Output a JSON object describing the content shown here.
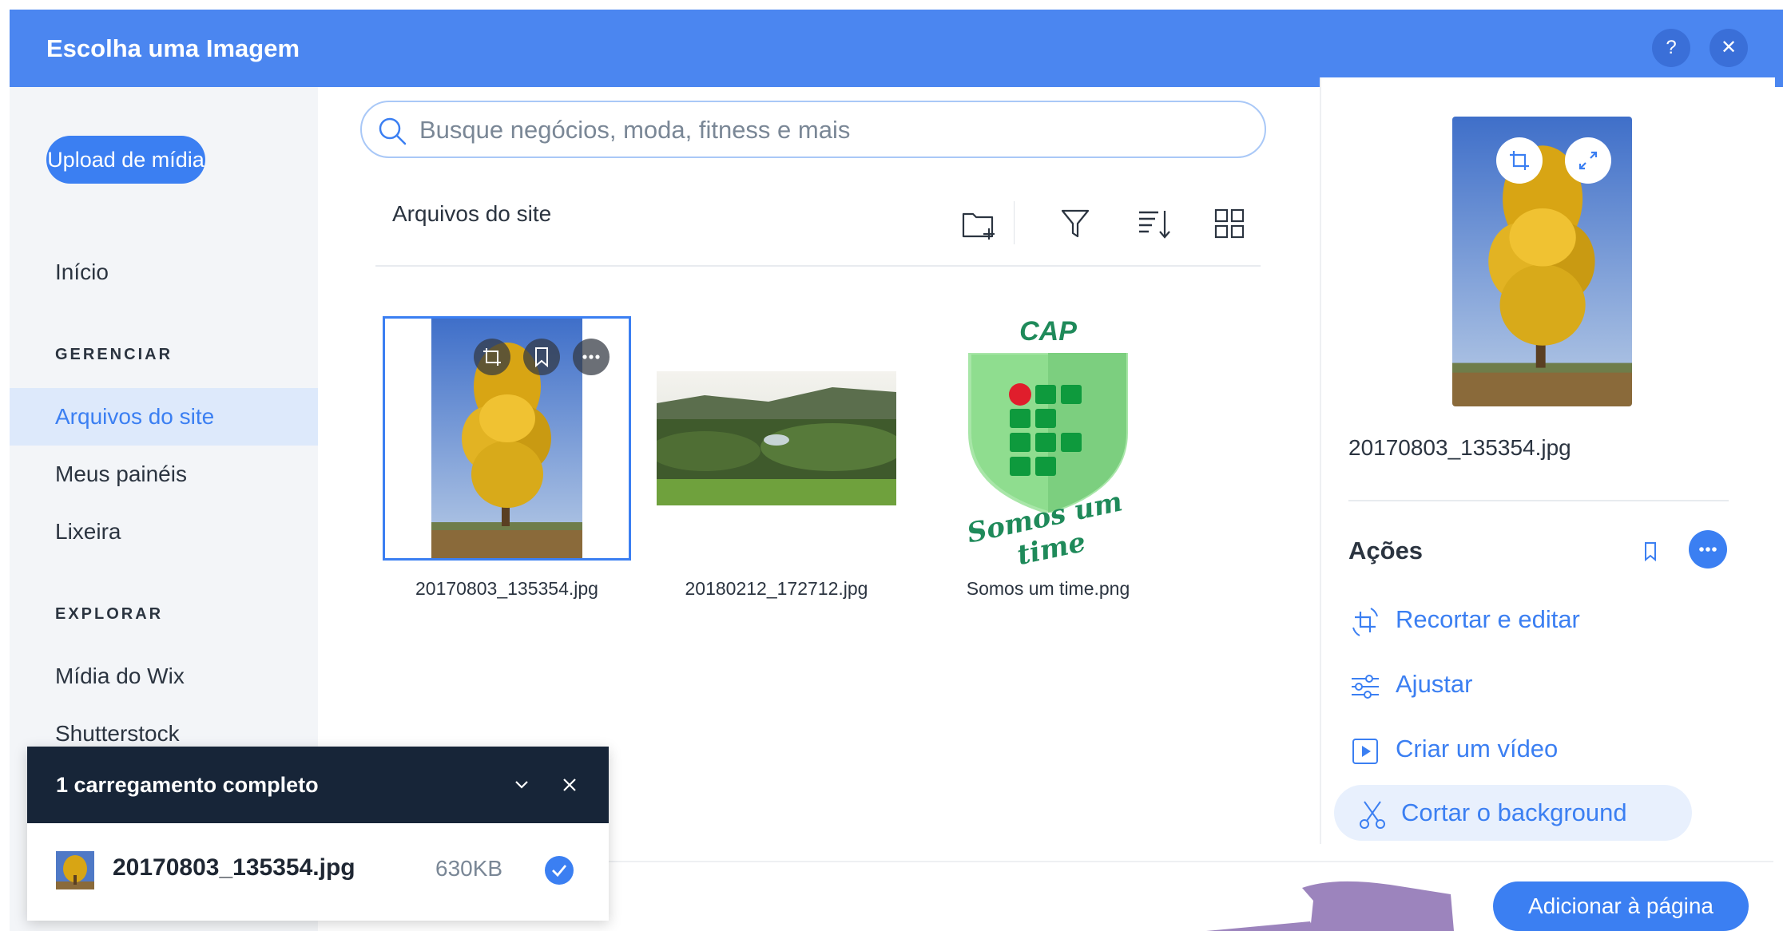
{
  "header": {
    "title": "Escolha uma Imagem",
    "help_label": "?",
    "close_label": "✕"
  },
  "sidebar": {
    "upload_label": "Upload de mídia",
    "home_label": "Início",
    "manage_heading": "GERENCIAR",
    "manage_items": [
      {
        "label": "Arquivos do site",
        "active": true
      },
      {
        "label": "Meus painéis",
        "active": false
      },
      {
        "label": "Lixeira",
        "active": false
      }
    ],
    "explore_heading": "EXPLORAR",
    "explore_items": [
      {
        "label": "Mídia do Wix"
      },
      {
        "label": "Shutterstock"
      }
    ]
  },
  "search": {
    "placeholder": "Busque negócios, moda, fitness e mais",
    "value": ""
  },
  "main": {
    "section_title": "Arquivos do site",
    "toolbar": [
      "new-folder-icon",
      "filter-icon",
      "sort-icon",
      "grid-view-icon"
    ],
    "files": [
      {
        "name": "20170803_135354.jpg",
        "selected": true
      },
      {
        "name": "20180212_172712.jpg",
        "selected": false
      },
      {
        "name": "Somos um time.png",
        "selected": false
      }
    ],
    "logo_text": {
      "top": "CAP",
      "bottom": "Somos um time"
    }
  },
  "preview": {
    "file_name": "20170803_135354.jpg",
    "actions_title": "Ações",
    "actions": [
      {
        "label": "Recortar e editar",
        "icon": "crop-icon"
      },
      {
        "label": "Ajustar",
        "icon": "adjust-icon"
      },
      {
        "label": "Criar um vídeo",
        "icon": "video-icon"
      },
      {
        "label": "Cortar o background",
        "icon": "scissors-icon",
        "highlighted": true
      }
    ]
  },
  "footer": {
    "add_label": "Adicionar à página"
  },
  "toast": {
    "title": "1 carregamento completo",
    "file_name": "20170803_135354.jpg",
    "file_size": "630KB"
  },
  "colors": {
    "accent": "#3b7ff2",
    "header_bg": "#4b86f0",
    "toast_header_bg": "#172538",
    "sidebar_bg": "#f3f5f8",
    "sidebar_active_bg": "#dde9fb"
  }
}
